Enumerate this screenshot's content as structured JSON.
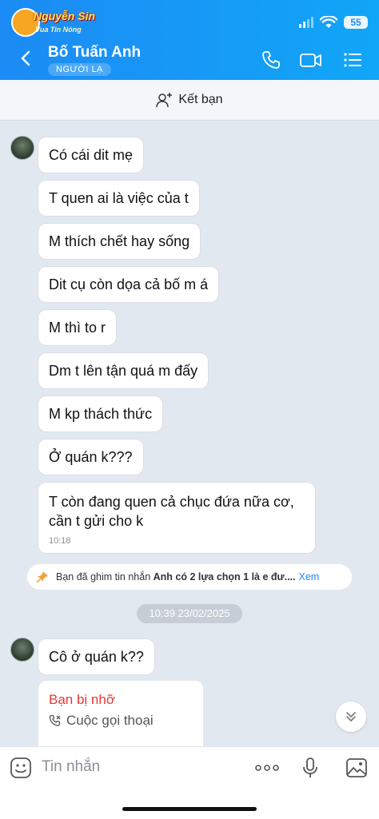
{
  "status_bar": {
    "logo_text": "Nguyễn Sin",
    "logo_sub": "Vua Tin Nóng",
    "battery": "55"
  },
  "header": {
    "contact_name": "Bố Tuấn Anh",
    "badge": "NGƯỜI LẠ"
  },
  "add_friend": {
    "label": "Kết bạn"
  },
  "messages": [
    "Có cái dit mẹ",
    "T quen ai là việc của t",
    "M thích chết hay sống",
    "Dit cụ còn dọa cả bố m á",
    "M thì to r",
    "Dm t lên tận quá m đấy",
    "M kp thách thức",
    "Ở quán k???"
  ],
  "last_message": {
    "line1": "T còn đang quen cả chục đứa nữa cơ,",
    "line2": "cần t gửi cho k",
    "time": "10:18"
  },
  "pinned": {
    "prefix": "Bạn đã ghim tin nhắn",
    "text": "Anh có 2 lựa chọn 1 là e đư....",
    "action": "Xem"
  },
  "date_chip": "10:39 23/02/2025",
  "message_after": "Cô ở quán k??",
  "missed_call": {
    "title": "Bạn bị nhỡ",
    "subtitle": "Cuộc gọi thoại"
  },
  "composer": {
    "placeholder": "Tin nhắn"
  },
  "colors": {
    "header_blue": "#1c8bf5",
    "missed_call_red": "#e53935",
    "link_blue": "#1c8bf5"
  }
}
